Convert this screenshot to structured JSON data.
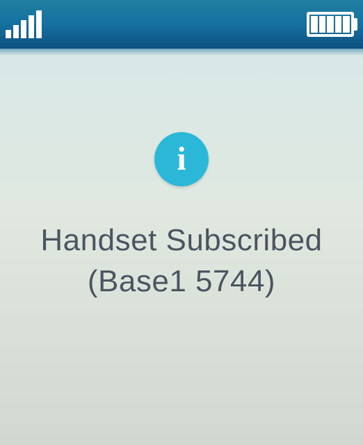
{
  "status": {
    "signal_level": 5,
    "battery_level": 5
  },
  "dialog": {
    "icon": "info-icon",
    "icon_letter": "i",
    "message_line1": "Handset Subscribed",
    "message_line2": "(Base1 5744)"
  },
  "colors": {
    "status_bar_bg": "#1570a0",
    "content_bg": "#d8e8e0",
    "icon_bg": "#2bb8d8",
    "text": "#4a5560"
  }
}
